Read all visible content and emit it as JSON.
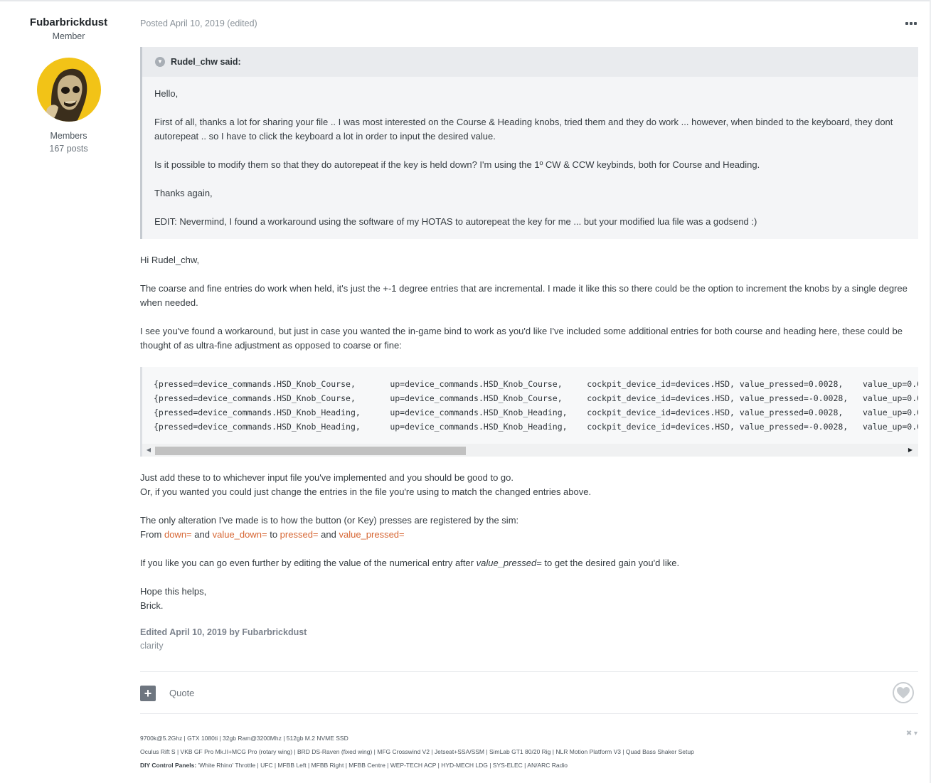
{
  "author": {
    "name": "Fubarbrickdust",
    "rank": "Member",
    "group": "Members",
    "posts": "167 posts"
  },
  "post": {
    "meta": "Posted April 10, 2019 (edited)",
    "menu_icon": "ellipsis-icon"
  },
  "quote": {
    "citation": "Rudel_chw said:",
    "paragraphs": [
      "Hello,",
      "First of all, thanks a lot for sharing your file .. I was most interested on the Course & Heading knobs, tried them and they do work ... however, when binded to the keyboard, they dont autorepeat .. so I have to click the keyboard a lot in order to input the desired value.",
      "Is it possible to modify them so that they do autorepeat if the key is held down? I'm using the 1º CW & CCW keybinds, both for Course and Heading.",
      "Thanks again,",
      "EDIT: Nevermind, I found a workaround using the software of my HOTAS to autorepeat the key for me ... but your modified lua file was a godsend :)"
    ]
  },
  "body": {
    "p1": "Hi Rudel_chw,",
    "p2": "The coarse and fine entries do work when held, it's just the +-1 degree entries that are incremental. I made it like this so there could be the option to increment the knobs by a single degree when needed.",
    "p3": "I see you've found a workaround, but just in case you wanted the in-game bind to work as you'd like I've included some additional entries for both course and heading here, these could be thought of as ultra-fine adjustment as opposed to coarse or fine:",
    "code": [
      "{pressed=device_commands.HSD_Knob_Course,       up=device_commands.HSD_Knob_Course,     cockpit_device_id=devices.HSD, value_pressed=0.0028,    value_up=0.0",
      "{pressed=device_commands.HSD_Knob_Course,       up=device_commands.HSD_Knob_Course,     cockpit_device_id=devices.HSD, value_pressed=-0.0028,   value_up=0.0",
      "{pressed=device_commands.HSD_Knob_Heading,      up=device_commands.HSD_Knob_Heading,    cockpit_device_id=devices.HSD, value_pressed=0.0028,    value_up=0.0",
      "{pressed=device_commands.HSD_Knob_Heading,      up=device_commands.HSD_Knob_Heading,    cockpit_device_id=devices.HSD, value_pressed=-0.0028,   value_up=0.0"
    ],
    "p4_line1": "Just add these to to whichever input file you've implemented and you should be good to go.",
    "p4_line2": "Or, if you wanted you could just change the entries in the file you're using to match the changed entries above.",
    "p5_line1": "The only alteration I've made is to how the button (or Key) presses are registered by the sim:",
    "p5_from": "From",
    "p5_down": "down=",
    "p5_and1": "and",
    "p5_value_down": "value_down=",
    "p5_to": "to",
    "p5_pressed": "pressed=",
    "p5_and2": "and",
    "p5_value_pressed": "value_pressed=",
    "p6_before": "If you like you can go even further by editing the value of the numerical entry after",
    "p6_italic": "value_pressed=",
    "p6_after": "to get the desired gain you'd like.",
    "p7_line1": "Hope this helps,",
    "p7_line2": "Brick."
  },
  "edit": {
    "edited_line": "Edited April 10, 2019 by Fubarbrickdust",
    "reason": "clarity"
  },
  "controls": {
    "multiquote_label": "+",
    "quote_label": "Quote",
    "react_icon": "heart-icon"
  },
  "signature": {
    "line1": "9700k@5.2Ghz | GTX 1080ti | 32gb Ram@3200Mhz | 512gb M.2 NVME SSD",
    "line2": "Oculus Rift S | VKB GF Pro Mk.II+MCG Pro (rotary wing) | BRD DS-Raven (fixed wing) | MFG Crosswind V2 | Jetseat+SSA/SSM | SimLab GT1 80/20 Rig | NLR Motion Platform V3 | Quad Bass Shaker Setup",
    "line3_label": "DIY Control Panels:",
    "line3_rest": "'White Rhino' Throttle | UFC | MFBB Left | MFBB Right | MFBB Centre | WEP-TECH ACP | HYD-MECH LDG | SYS-ELEC | AN/ARC Radio",
    "hide_label": "✖ ▾"
  }
}
